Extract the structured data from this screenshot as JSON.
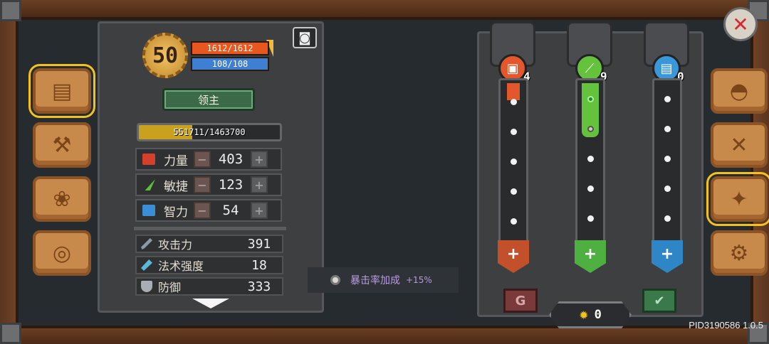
{
  "character": {
    "level": "50",
    "hp": "1612/1612",
    "mp": "108/108",
    "title": "领主",
    "xp_text": "551711/1463700",
    "xp_fraction": 0.377
  },
  "stats": [
    {
      "label": "力量",
      "value": "403",
      "icon_color": "#d6402a",
      "icon": "fist-icon"
    },
    {
      "label": "敏捷",
      "value": "123",
      "icon_color": "#5fbf3a",
      "icon": "feather-icon"
    },
    {
      "label": "智力",
      "value": "54",
      "icon_color": "#3a8ed6",
      "icon": "book-icon"
    }
  ],
  "attributes": [
    {
      "label": "攻击力",
      "value": "391",
      "icon": "sword-icon"
    },
    {
      "label": "法术强度",
      "value": "18",
      "icon": "wand-icon"
    },
    {
      "label": "防御",
      "value": "333",
      "icon": "shield-icon"
    }
  ],
  "tooltip": {
    "label": "暴击率加成",
    "value": "+15%"
  },
  "branches": [
    {
      "name": "strength",
      "count": "4",
      "color": "#e2572b"
    },
    {
      "name": "agility",
      "count": "9",
      "color": "#65c23c"
    },
    {
      "name": "intelligence",
      "count": "0",
      "color": "#3a97d8"
    }
  ],
  "talent_points": "0",
  "version": "PID3190586 1.0.5",
  "colors": {
    "gold": "#f4c21a",
    "hp": "#e8571f",
    "mp": "#3f7fd3"
  }
}
